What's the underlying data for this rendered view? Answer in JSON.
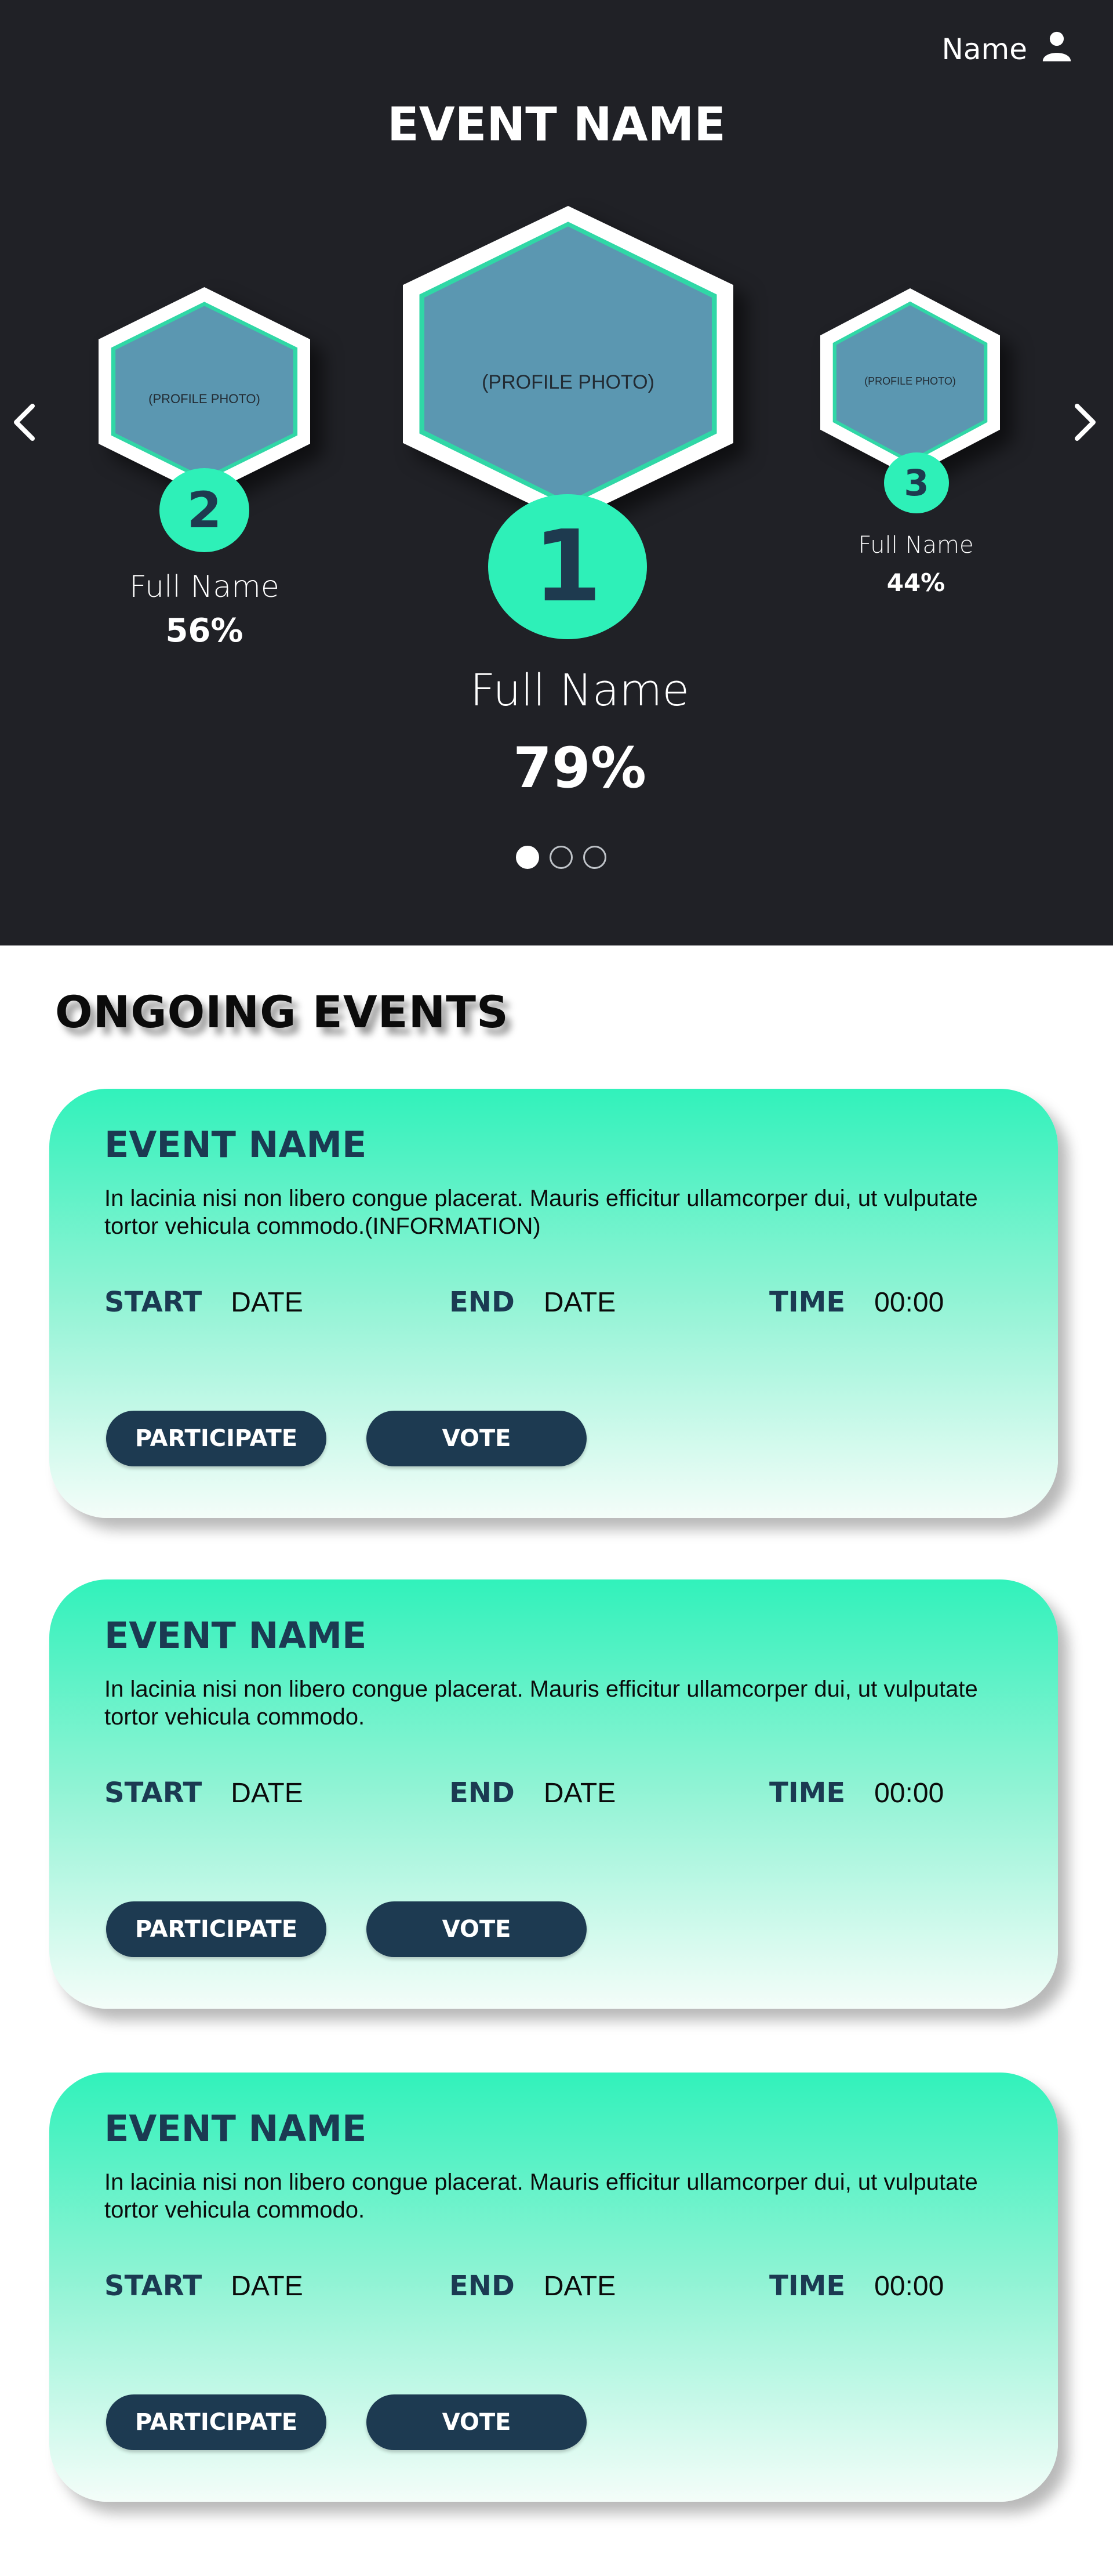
{
  "header": {
    "user_name": "Name",
    "user_icon": "person-icon"
  },
  "hero": {
    "title": "EVENT NAME",
    "nav": {
      "prev_icon": "chevron-left-icon",
      "next_icon": "chevron-right-icon"
    },
    "podium": [
      {
        "rank": "1",
        "photo_label": "(PROFILE PHOTO)",
        "full_name": "Full Name",
        "percent": "79%"
      },
      {
        "rank": "2",
        "photo_label": "(PROFILE PHOTO)",
        "full_name": "Full Name",
        "percent": "56%"
      },
      {
        "rank": "3",
        "photo_label": "(PROFILE PHOTO)",
        "full_name": "Full Name",
        "percent": "44%"
      }
    ],
    "carousel_pages": 3,
    "carousel_active_page": 1
  },
  "ongoing": {
    "title": "ONGOING EVENTS",
    "events": [
      {
        "name": "EVENT NAME",
        "info": "In lacinia nisi non libero congue placerat. Mauris efficitur ullamcorper dui, ut vulputate tortor vehicula commodo.(INFORMATION)",
        "start_label": "START",
        "start_value": "DATE",
        "end_label": "END",
        "end_value": "DATE",
        "time_label": "TIME",
        "time_value": "00:00",
        "participate_label": "PARTICIPATE",
        "vote_label": "VOTE"
      },
      {
        "name": "EVENT NAME",
        "info": "In lacinia nisi non libero congue placerat. Mauris efficitur ullamcorper dui, ut vulputate tortor vehicula commodo.",
        "start_label": "START",
        "start_value": "DATE",
        "end_label": "END",
        "end_value": "DATE",
        "time_label": "TIME",
        "time_value": "00:00",
        "participate_label": "PARTICIPATE",
        "vote_label": "VOTE"
      },
      {
        "name": "EVENT NAME",
        "info": "In lacinia nisi non libero congue placerat. Mauris efficitur ullamcorper dui, ut vulputate tortor vehicula commodo.",
        "start_label": "START",
        "start_value": "DATE",
        "end_label": "END",
        "end_value": "DATE",
        "time_label": "TIME",
        "time_value": "00:00",
        "participate_label": "PARTICIPATE",
        "vote_label": "VOTE"
      }
    ]
  },
  "colors": {
    "hero_bg": "#202126",
    "accent": "#2ef0b8",
    "navy": "#1d3a51",
    "photo_fill": "#5b97b1"
  }
}
